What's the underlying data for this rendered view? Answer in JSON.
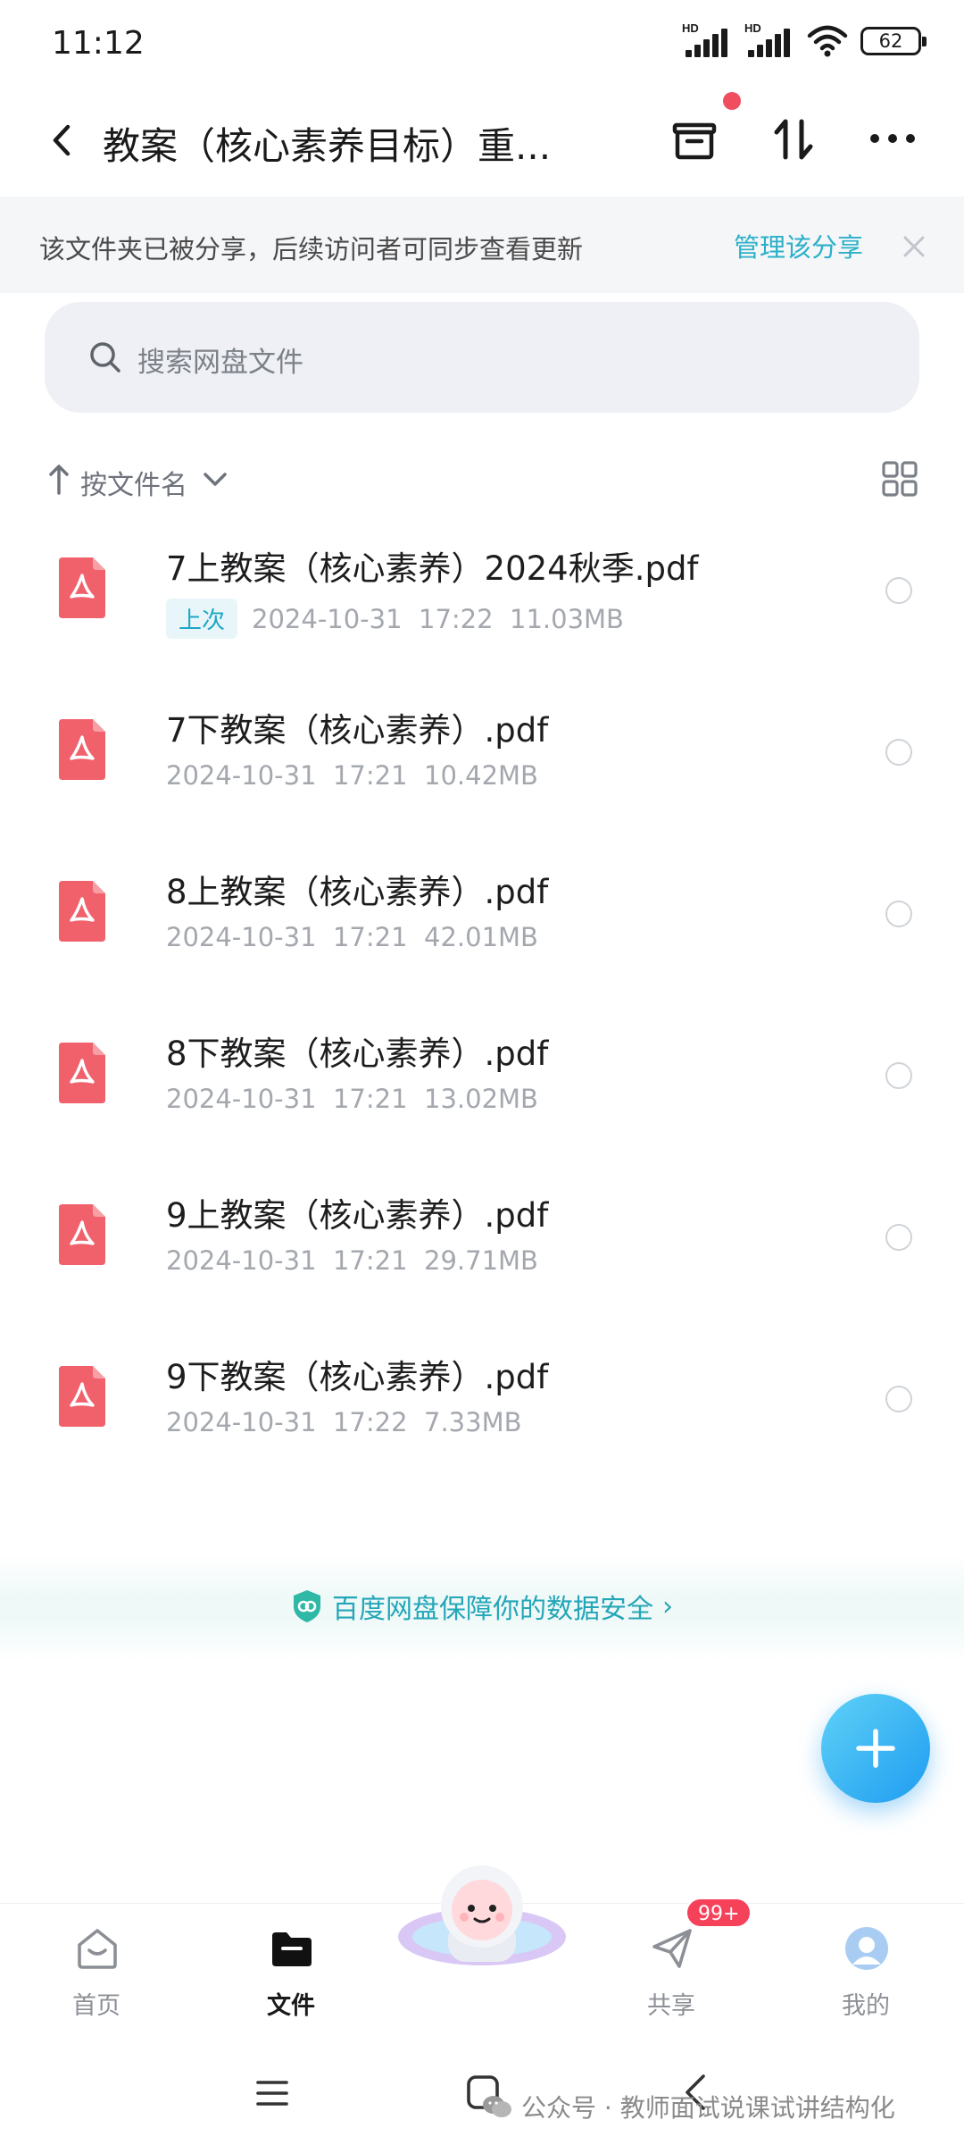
{
  "status_bar": {
    "time": "11:12",
    "signal_1_label": "HD",
    "signal_2_label": "HD",
    "battery": "62"
  },
  "header": {
    "title": "教案（核心素养目标）重...",
    "back_icon": "chevron-left-icon",
    "recycle_icon": "recycle-bin-icon",
    "transfer_icon": "transfer-icon",
    "more_icon": "more-icon"
  },
  "share_banner": {
    "text": "该文件夹已被分享，后续访问者可同步查看更新",
    "manage_label": "管理该分享",
    "accent_color": "#2bb0c9"
  },
  "search": {
    "placeholder": "搜索网盘文件"
  },
  "sort": {
    "label": "按文件名"
  },
  "files": [
    {
      "name": "7上教案（核心素养）2024秋季.pdf",
      "badge": "上次",
      "date": "2024-10-31",
      "time": "17:22",
      "size": "11.03MB"
    },
    {
      "name": "7下教案（核心素养）.pdf",
      "date": "2024-10-31",
      "time": "17:21",
      "size": "10.42MB"
    },
    {
      "name": "8上教案（核心素养）.pdf",
      "date": "2024-10-31",
      "time": "17:21",
      "size": "42.01MB"
    },
    {
      "name": "8下教案（核心素养）.pdf",
      "date": "2024-10-31",
      "time": "17:21",
      "size": "13.02MB"
    },
    {
      "name": "9上教案（核心素养）.pdf",
      "date": "2024-10-31",
      "time": "17:21",
      "size": "29.71MB"
    },
    {
      "name": "9下教案（核心素养）.pdf",
      "date": "2024-10-31",
      "time": "17:22",
      "size": "7.33MB"
    }
  ],
  "security_banner": {
    "text": "百度网盘保障你的数据安全",
    "chevron": "›",
    "color": "#24a6b8"
  },
  "bottom_nav": {
    "items": [
      {
        "label": "首页",
        "icon": "home-icon"
      },
      {
        "label": "文件",
        "icon": "folder-icon"
      },
      {
        "label": "共享",
        "icon": "send-icon"
      },
      {
        "label": "我的",
        "icon": "avatar-icon"
      }
    ],
    "share_badge": "99+"
  },
  "watermark": {
    "text": "公众号 · 教师面试说课试讲结构化"
  }
}
